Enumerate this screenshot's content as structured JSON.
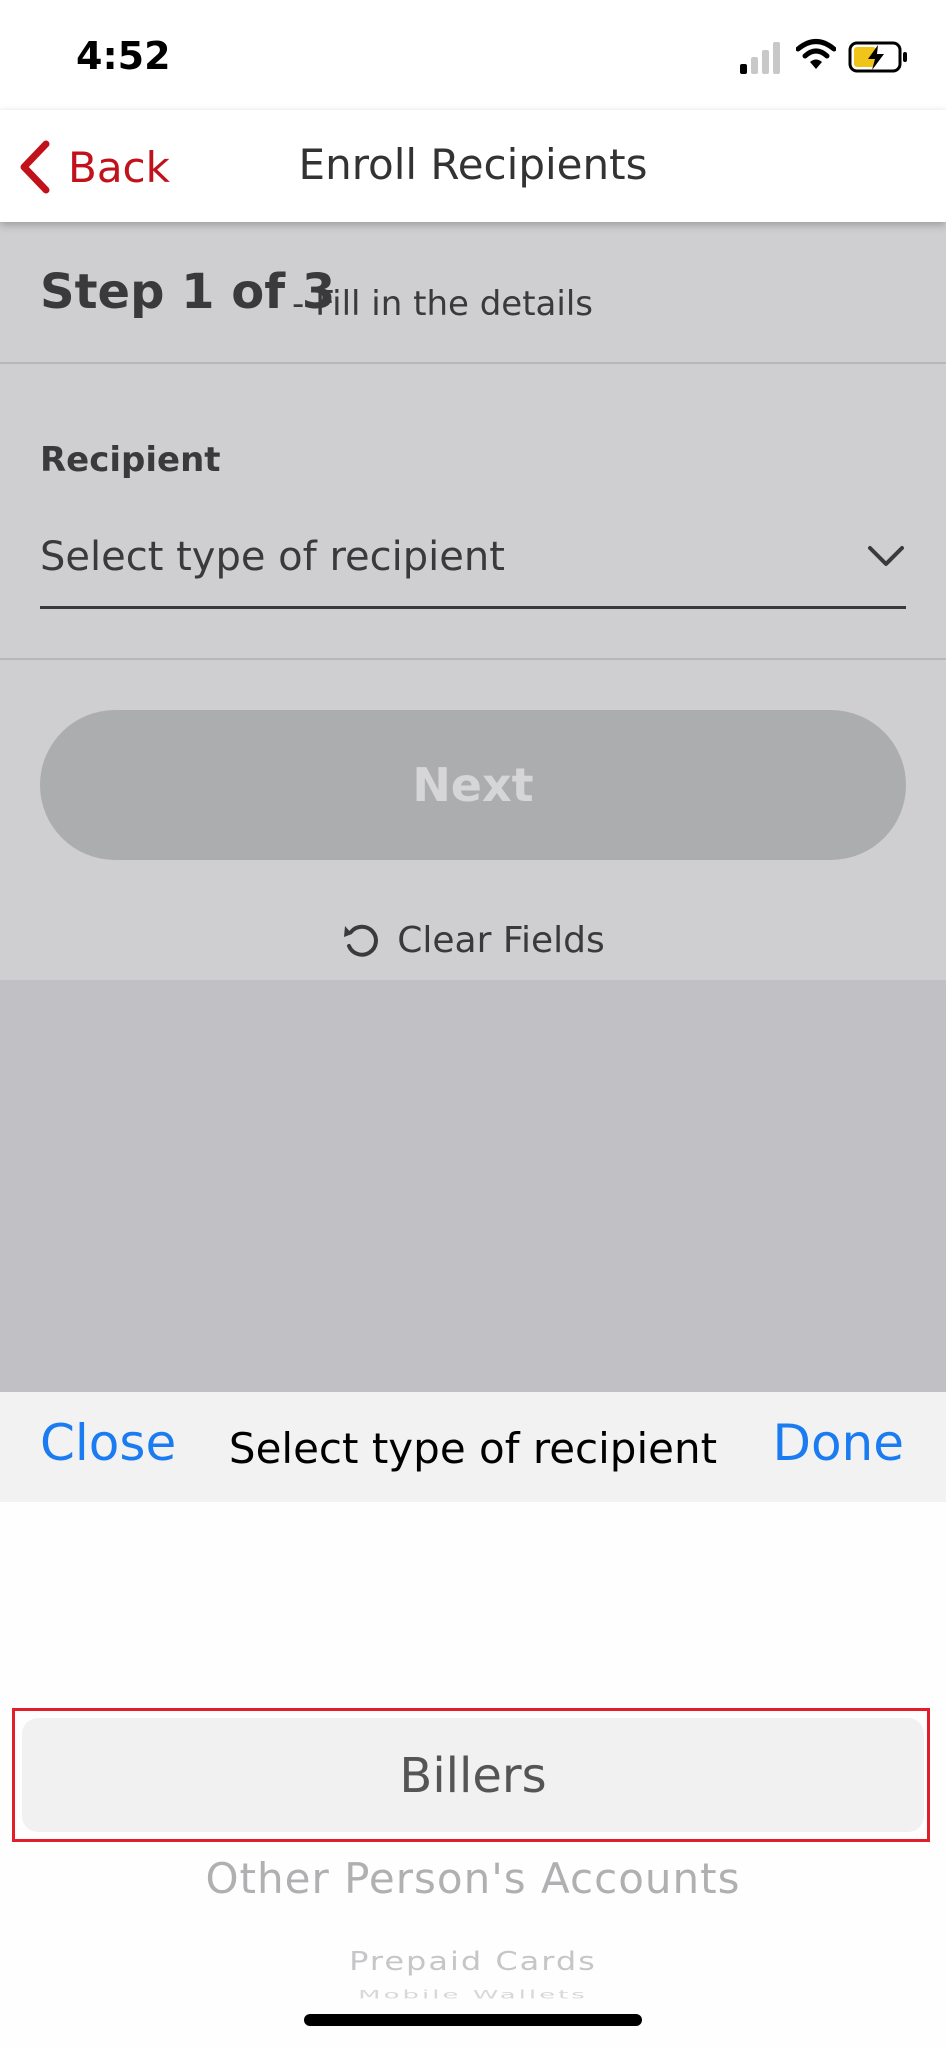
{
  "status_bar": {
    "time": "4:52",
    "icons": [
      "signal-icon",
      "wifi-icon",
      "battery-charging-icon"
    ]
  },
  "nav": {
    "back_label": "Back",
    "title": "Enroll Recipients",
    "accent_color": "#c1121c"
  },
  "form": {
    "step_main": "Step 1 of 3",
    "step_sub": "- Fill in the details",
    "recipient_label": "Recipient",
    "recipient_value": "Select type of recipient",
    "next_label": "Next",
    "clear_label": "Clear Fields"
  },
  "picker": {
    "close_label": "Close",
    "title": "Select type of recipient",
    "done_label": "Done",
    "link_color": "#1a7cf0",
    "options": [
      "Billers",
      "Other Person's Accounts",
      "Prepaid Cards",
      "Mobile Wallets"
    ],
    "selected": "Billers"
  }
}
